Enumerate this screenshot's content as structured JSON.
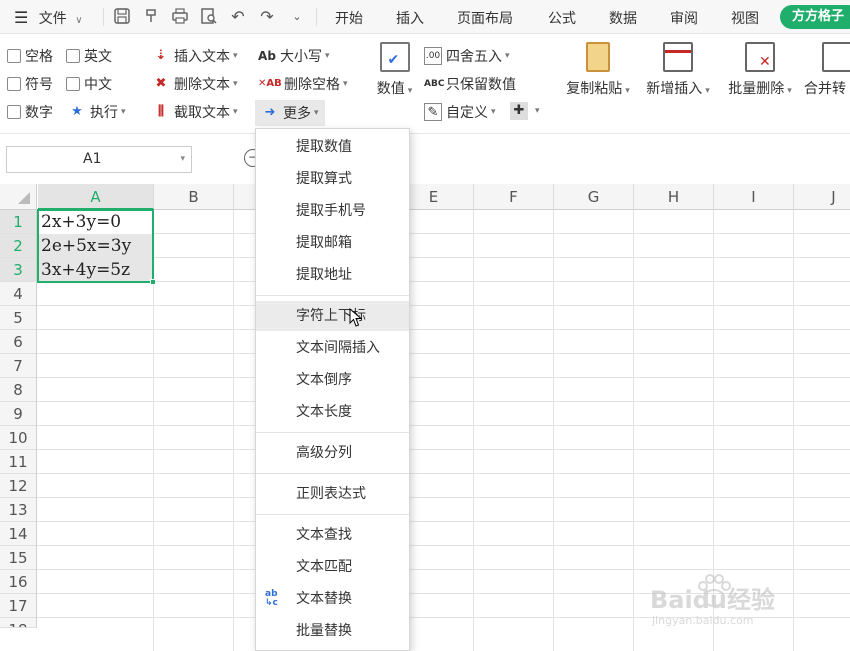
{
  "menubar": {
    "file_label": "文件",
    "tabs": [
      "开始",
      "插入",
      "页面布局",
      "公式",
      "数据",
      "审阅",
      "视图"
    ],
    "brand_label": "方方格子"
  },
  "ribbon": {
    "checkboxes": [
      "空格",
      "英文",
      "符号",
      "中文",
      "数字"
    ],
    "execute_label": "执行",
    "insert_text": "插入文本",
    "delete_text": "删除文本",
    "extract_text": "截取文本",
    "case_label": "大小写",
    "delete_space": "删除空格",
    "more_label": "更多",
    "numeric_label": "数值",
    "round_label": "四舍五入",
    "keep_numeric": "只保留数值",
    "custom_label": "自定义",
    "copy_paste": "复制粘贴",
    "add_insert": "新增插入",
    "batch_delete": "批量删除",
    "merge_label": "合并转"
  },
  "formula_bar": {
    "cell_ref": "A1"
  },
  "sheet": {
    "columns": [
      "A",
      "B",
      "C",
      "D",
      "E",
      "F",
      "G",
      "H",
      "I",
      "J"
    ],
    "rows": [
      "1",
      "2",
      "3",
      "4",
      "5",
      "6",
      "7",
      "8",
      "9",
      "10",
      "11",
      "12",
      "13",
      "14",
      "15",
      "16",
      "17",
      "18"
    ],
    "cells": [
      "2x+3y=0",
      "2e+5x=3y",
      "3x+4y=5z"
    ],
    "selection_color": "#1fae6b"
  },
  "dropdown": {
    "group1": [
      "提取数值",
      "提取算式",
      "提取手机号",
      "提取邮箱",
      "提取地址"
    ],
    "group2": [
      "字符上下标",
      "文本间隔插入",
      "文本倒序",
      "文本长度"
    ],
    "group3": [
      "高级分列"
    ],
    "group4": [
      "正则表达式"
    ],
    "group5": [
      "文本查找",
      "文本匹配",
      "文本替换",
      "批量替换"
    ]
  },
  "watermark": {
    "brand": "Baidu经验",
    "url": "jingyan.baidu.com"
  }
}
